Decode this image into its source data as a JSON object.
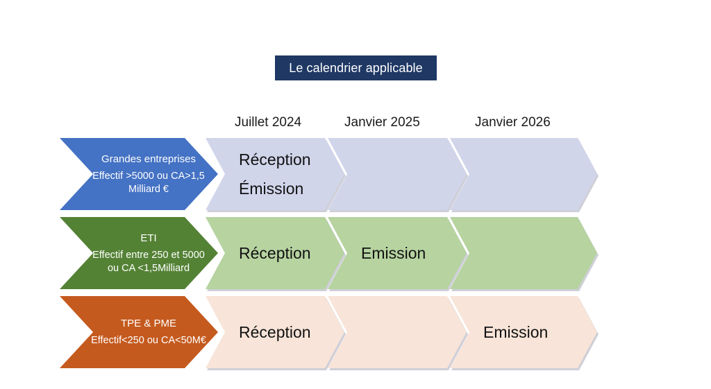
{
  "title": {
    "text": "Le calendrier applicable",
    "background": "#1F3864",
    "color": "#FFFFFF"
  },
  "columns": [
    {
      "label": "Juillet 2024"
    },
    {
      "label": "Janvier 2025"
    },
    {
      "label": "Janvier 2026"
    }
  ],
  "rows": [
    {
      "key": "grandes-entreprises",
      "title": "Grandes entreprises",
      "subtitle": "Effectif >5000 ou CA>1,5 Milliard €",
      "label_color": "#4472C4",
      "stage_color": "#D0D5EA",
      "stages": [
        {
          "labels": [
            "Réception",
            "Émission"
          ]
        },
        {
          "labels": []
        },
        {
          "labels": []
        }
      ]
    },
    {
      "key": "eti",
      "title": "ETI",
      "subtitle": "Effectif entre 250 et 5000 ou CA <1,5Milliard",
      "label_color": "#548235",
      "stage_color": "#B6D3A0",
      "stages": [
        {
          "labels": [
            "Réception"
          ]
        },
        {
          "labels": [
            "Emission"
          ]
        },
        {
          "labels": []
        }
      ]
    },
    {
      "key": "tpe-pme",
      "title": "TPE & PME",
      "subtitle": "Effectif<250 ou CA<50M€",
      "label_color": "#C55A1E",
      "stage_color": "#F8E4D8",
      "stages": [
        {
          "labels": [
            "Réception"
          ]
        },
        {
          "labels": []
        },
        {
          "labels": [
            "Emission"
          ]
        }
      ]
    }
  ]
}
